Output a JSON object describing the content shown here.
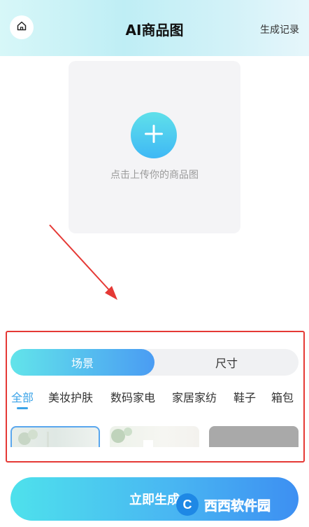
{
  "header": {
    "title": "AI商品图",
    "right_link": "生成记录"
  },
  "upload": {
    "hint": "点击上传你的商品图"
  },
  "segments": {
    "active": "场景",
    "inactive": "尺寸"
  },
  "categories": [
    "全部",
    "美妆护肤",
    "数码家电",
    "家居家纺",
    "鞋子",
    "箱包"
  ],
  "selected_category": "全部",
  "primary_button": {
    "label": "立即生成"
  },
  "watermark": {
    "text": "西西软件园"
  },
  "colors": {
    "accent": "#3aa3e8",
    "annotation": "#e53935"
  },
  "icons": {
    "home": "home-icon",
    "plus": "plus-icon"
  }
}
